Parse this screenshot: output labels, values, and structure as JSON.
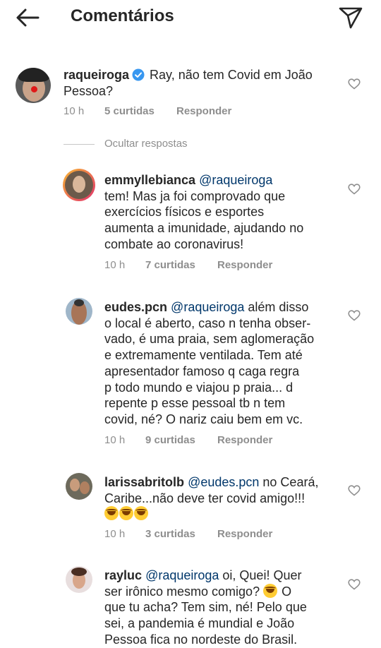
{
  "header": {
    "title": "Comentários"
  },
  "icons": {
    "back": "back-arrow-icon",
    "send": "send-paper-plane-icon",
    "like": "heart-outline-icon",
    "verified": "verified-badge-icon"
  },
  "main_comment": {
    "username": "raqueiroga",
    "text": " Ray, não tem Covid em João",
    "text2": "Pessoa?",
    "time": "10 h",
    "likes": "5 curtidas",
    "reply": "Responder"
  },
  "hide_replies": "Ocultar respostas",
  "replies": [
    {
      "username": "emmyllebianca",
      "mention": "@raqueiroga",
      "lines": [
        "tem! Mas ja foi comprovado que",
        "exercícios físicos e esportes",
        "aumenta a imunidade, ajudando no",
        "combate ao coronavirus!"
      ],
      "time": "10 h",
      "likes": "7 curtidas",
      "reply": "Responder"
    },
    {
      "username": "eudes.pcn",
      "mention": "@raqueiroga",
      "first_rest": " além disso",
      "lines": [
        "o local é aberto, caso n tenha obser-",
        "vado, é uma praia, sem aglomeração",
        "e extremamente ventilada. Tem até",
        "apresentador famoso q caga regra",
        "p todo mundo e viajou p praia... d",
        "repente p esse pessoal tb n tem",
        "covid, né? O nariz caiu bem em vc."
      ],
      "time": "10 h",
      "likes": "9 curtidas",
      "reply": "Responder"
    },
    {
      "username": "larissabritolb",
      "mention": "@eudes.pcn",
      "first_rest": " no Ceará,",
      "lines": [
        "Caribe...não deve ter covid amigo!!!"
      ],
      "time": "10 h",
      "likes": "3 curtidas",
      "reply": "Responder"
    },
    {
      "username": "rayluc",
      "mention": "@raqueiroga",
      "first_rest": " oi, Quei! Quer",
      "lines": [
        "ser irônico mesmo comigo?",
        " O",
        "que tu acha? Tem sim, né! Pelo que",
        "sei, a pandemia é mundial e João",
        "Pessoa fica no nordeste do Brasil."
      ]
    }
  ]
}
